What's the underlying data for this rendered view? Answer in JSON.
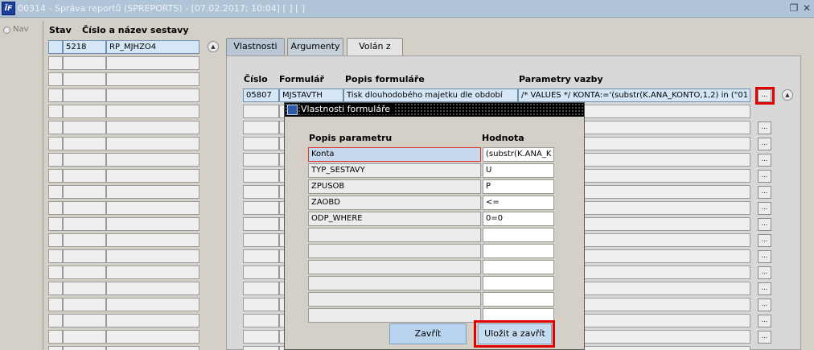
{
  "window": {
    "logo_text": "ÏF",
    "title": "00314 - Správa reportů (SPREPORTS) - [07.02.2017; 10:04]  [ ]  [ ]"
  },
  "nav": {
    "label": "Nav"
  },
  "left_grid": {
    "headers": {
      "stav": "Stav",
      "nazev": "Číslo a název sestavy"
    },
    "rows": [
      {
        "stav": "",
        "cislo": "5218",
        "nazev": "RP_MJHZO4"
      }
    ]
  },
  "tabs": [
    {
      "label": "Vlastnosti"
    },
    {
      "label": "Argumenty"
    },
    {
      "label": "Volán z"
    }
  ],
  "main_grid": {
    "headers": {
      "cislo": "Číslo",
      "formular": "Formulář",
      "popis": "Popis formuláře",
      "parametry": "Parametry vazby"
    },
    "rows": [
      {
        "cislo": "05807",
        "formular": "MJSTAVTH",
        "popis": "Tisk dlouhodobého majetku dle období",
        "parametry": "/* VALUES */ KONTA:='(substr(K.ANA_KONTO,1,2) in (\"01"
      }
    ]
  },
  "row_button_label": "...",
  "dialog": {
    "title": "Vlastnosti formuláře",
    "headers": {
      "popis": "Popis parametru",
      "hodnota": "Hodnota"
    },
    "rows": [
      {
        "popis": "Konta",
        "hodnota": "(substr(K.ANA_K"
      },
      {
        "popis": "TYP_SESTAVY",
        "hodnota": "U"
      },
      {
        "popis": "ZPUSOB",
        "hodnota": "P"
      },
      {
        "popis": "ZAOBD",
        "hodnota": "<="
      },
      {
        "popis": "ODP_WHERE",
        "hodnota": "0=0"
      }
    ],
    "close_label": "Zavřít",
    "save_label": "Uložit a zavřít"
  }
}
